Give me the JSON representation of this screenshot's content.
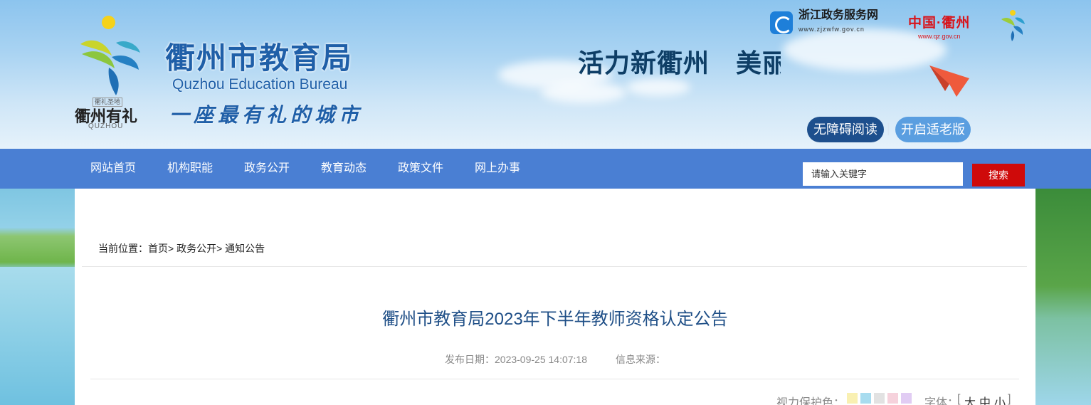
{
  "header": {
    "logo_seal_top": "衢礼圣地",
    "logo_seal_main": "衢州有礼",
    "logo_seal_en": "QUZHOU",
    "title": "衢州市教育局",
    "subtitle_en": "Quzhou Education Bureau",
    "slogan": "一座最有礼的城市",
    "banner_motto": "活力新衢州　美丽大花园",
    "zjzw_name": "浙江政务服务网",
    "zjzw_url": "www.zjzwfw.gov.cn",
    "zgqz_name": "中国·衢州",
    "zgqz_url": "www.qz.gov.cn",
    "accessibility_button": "无障碍阅读",
    "separator": "|",
    "elder_mode_button": "开启适老版"
  },
  "nav": {
    "items": [
      "网站首页",
      "机构职能",
      "政务公开",
      "教育动态",
      "政策文件",
      "网上办事"
    ],
    "search_placeholder": "请输入关键字",
    "search_button": "搜索"
  },
  "breadcrumb": {
    "label": "当前位置：",
    "items": [
      "首页>",
      "政务公开>",
      "通知公告"
    ]
  },
  "article": {
    "title": "衢州市教育局2023年下半年教师资格认定公告",
    "publish_date_label": "发布日期：",
    "publish_date": "2023-09-25 14:07:18",
    "source_label": "信息来源："
  },
  "tools": {
    "eye_protection_label": "视力保护色：",
    "swatch_colors": [
      "#f9f0b2",
      "#a8dcef",
      "#e2e2e2",
      "#f6d2dc",
      "#e1ccf3"
    ],
    "font_label": "字体：",
    "bracket_open": "[",
    "bracket_close": "]",
    "font_sizes": [
      "大",
      "中",
      "小"
    ]
  },
  "colors": {
    "nav_bg": "#4a7fd3",
    "title_blue": "#1f5fa8",
    "search_red": "#cf0a0a",
    "accessibility_bg": "#1d4f8d",
    "elder_bg": "#5a9ee0"
  }
}
